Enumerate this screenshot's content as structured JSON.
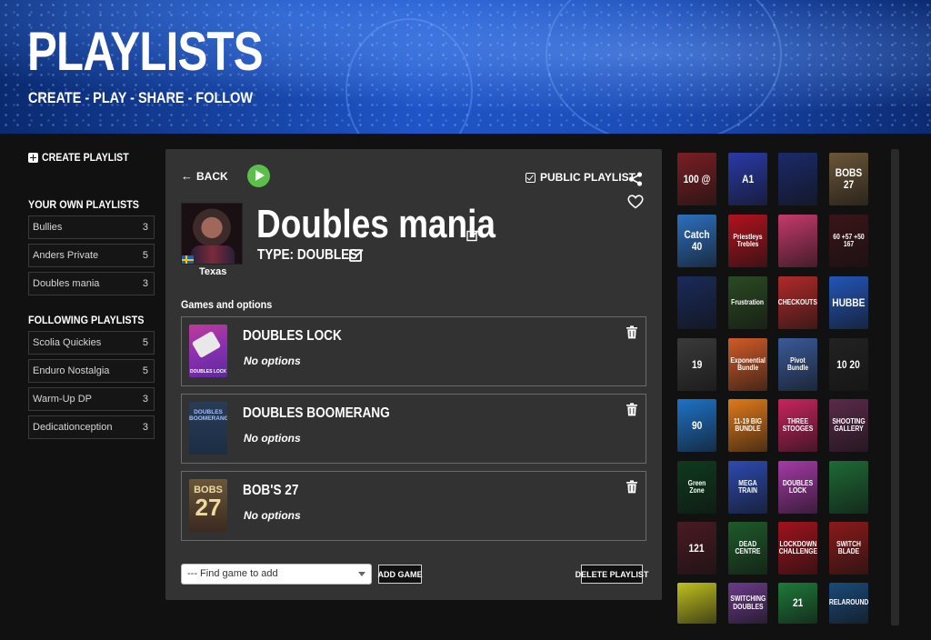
{
  "header": {
    "title": "PLAYLISTS",
    "subtitle": "CREATE - PLAY - SHARE - FOLLOW"
  },
  "sidebar": {
    "create_label": "CREATE PLAYLIST",
    "own_heading": "YOUR OWN PLAYLISTS",
    "own_items": [
      {
        "label": "Bullies",
        "count": "3"
      },
      {
        "label": "Anders Private",
        "count": "5"
      },
      {
        "label": "Doubles mania",
        "count": "3"
      }
    ],
    "following_heading": "FOLLOWING PLAYLISTS",
    "following_items": [
      {
        "label": "Scolia Quickies",
        "count": "5"
      },
      {
        "label": "Enduro Nostalgia",
        "count": "5"
      },
      {
        "label": "Warm-Up DP",
        "count": "3"
      },
      {
        "label": "Dedicationception",
        "count": "3"
      }
    ]
  },
  "panel": {
    "back_label": "BACK",
    "public_label": "PUBLIC PLAYLIST",
    "player_name": "Texas",
    "title": "Doubles mania",
    "type_label": "TYPE: DOUBLES",
    "games_label": "Games and options",
    "games": [
      {
        "name": "DOUBLES LOCK",
        "options": "No options",
        "thumb_text": "DOUBLES LOCK"
      },
      {
        "name": "DOUBLES BOOMERANG",
        "options": "No options",
        "thumb_text": "DOUBLES BOOMERANG"
      },
      {
        "name": "BOB'S 27",
        "options": "No options",
        "thumb_top": "BOBS",
        "thumb_num": "27"
      }
    ],
    "find_placeholder": "--- Find game to add",
    "add_game_label": "ADD GAME",
    "delete_label": "DELETE PLAYLIST"
  },
  "game_tiles": [
    {
      "text": "100 @",
      "bg": "#7a1e24"
    },
    {
      "text": "A1",
      "bg": "#2a3aa8"
    },
    {
      "text": "",
      "bg": "#1b2a6a"
    },
    {
      "text": "BOBS 27",
      "bg": "#6b5638"
    },
    {
      "text": "Catch 40",
      "bg": "#2d6fc0"
    },
    {
      "text": "Priestleys Trebles",
      "bg": "#b0121e"
    },
    {
      "text": "",
      "bg": "#c43a6a"
    },
    {
      "text": "60 +57 +50 167",
      "bg": "#3a1418"
    },
    {
      "text": "",
      "bg": "#1a2a5a"
    },
    {
      "text": "Frustration",
      "bg": "#2a4a22"
    },
    {
      "text": "CHECKOUTS",
      "bg": "#b02a2a"
    },
    {
      "text": "HUBBE",
      "bg": "#2256b8"
    },
    {
      "text": "19",
      "bg": "#3a3a3a"
    },
    {
      "text": "Exponential Bundle",
      "bg": "#d05a28"
    },
    {
      "text": "Pivot Bundle",
      "bg": "#3a5a9a"
    },
    {
      "text": "10 20",
      "bg": "#222222"
    },
    {
      "text": "90",
      "bg": "#1e72c8"
    },
    {
      "text": "11-19 BIG BUNDLE",
      "bg": "#e07a1a"
    },
    {
      "text": "THREE STOOGES",
      "bg": "#c8245e"
    },
    {
      "text": "SHOOTING GALLERY",
      "bg": "#5a2a4a"
    },
    {
      "text": "Green Zone",
      "bg": "#0e3a1e"
    },
    {
      "text": "MEGA TRAIN",
      "bg": "#2d4ab0"
    },
    {
      "text": "DOUBLES LOCK",
      "bg": "#a43aa6"
    },
    {
      "text": "",
      "bg": "#1e6a36"
    },
    {
      "text": "121",
      "bg": "#4a1a22"
    },
    {
      "text": "DEAD CENTRE",
      "bg": "#1e5a2a"
    },
    {
      "text": "LOCKDOWN CHALLENGE",
      "bg": "#a0121c"
    },
    {
      "text": "SWITCH BLADE",
      "bg": "#8a1a1a"
    },
    {
      "text": "",
      "bg": "#c0c020"
    },
    {
      "text": "SWITCHING DOUBLES",
      "bg": "#6a3a8a"
    },
    {
      "text": "21",
      "bg": "#1e7a3a"
    },
    {
      "text": "RELAROUND",
      "bg": "#1a4a7a"
    }
  ]
}
